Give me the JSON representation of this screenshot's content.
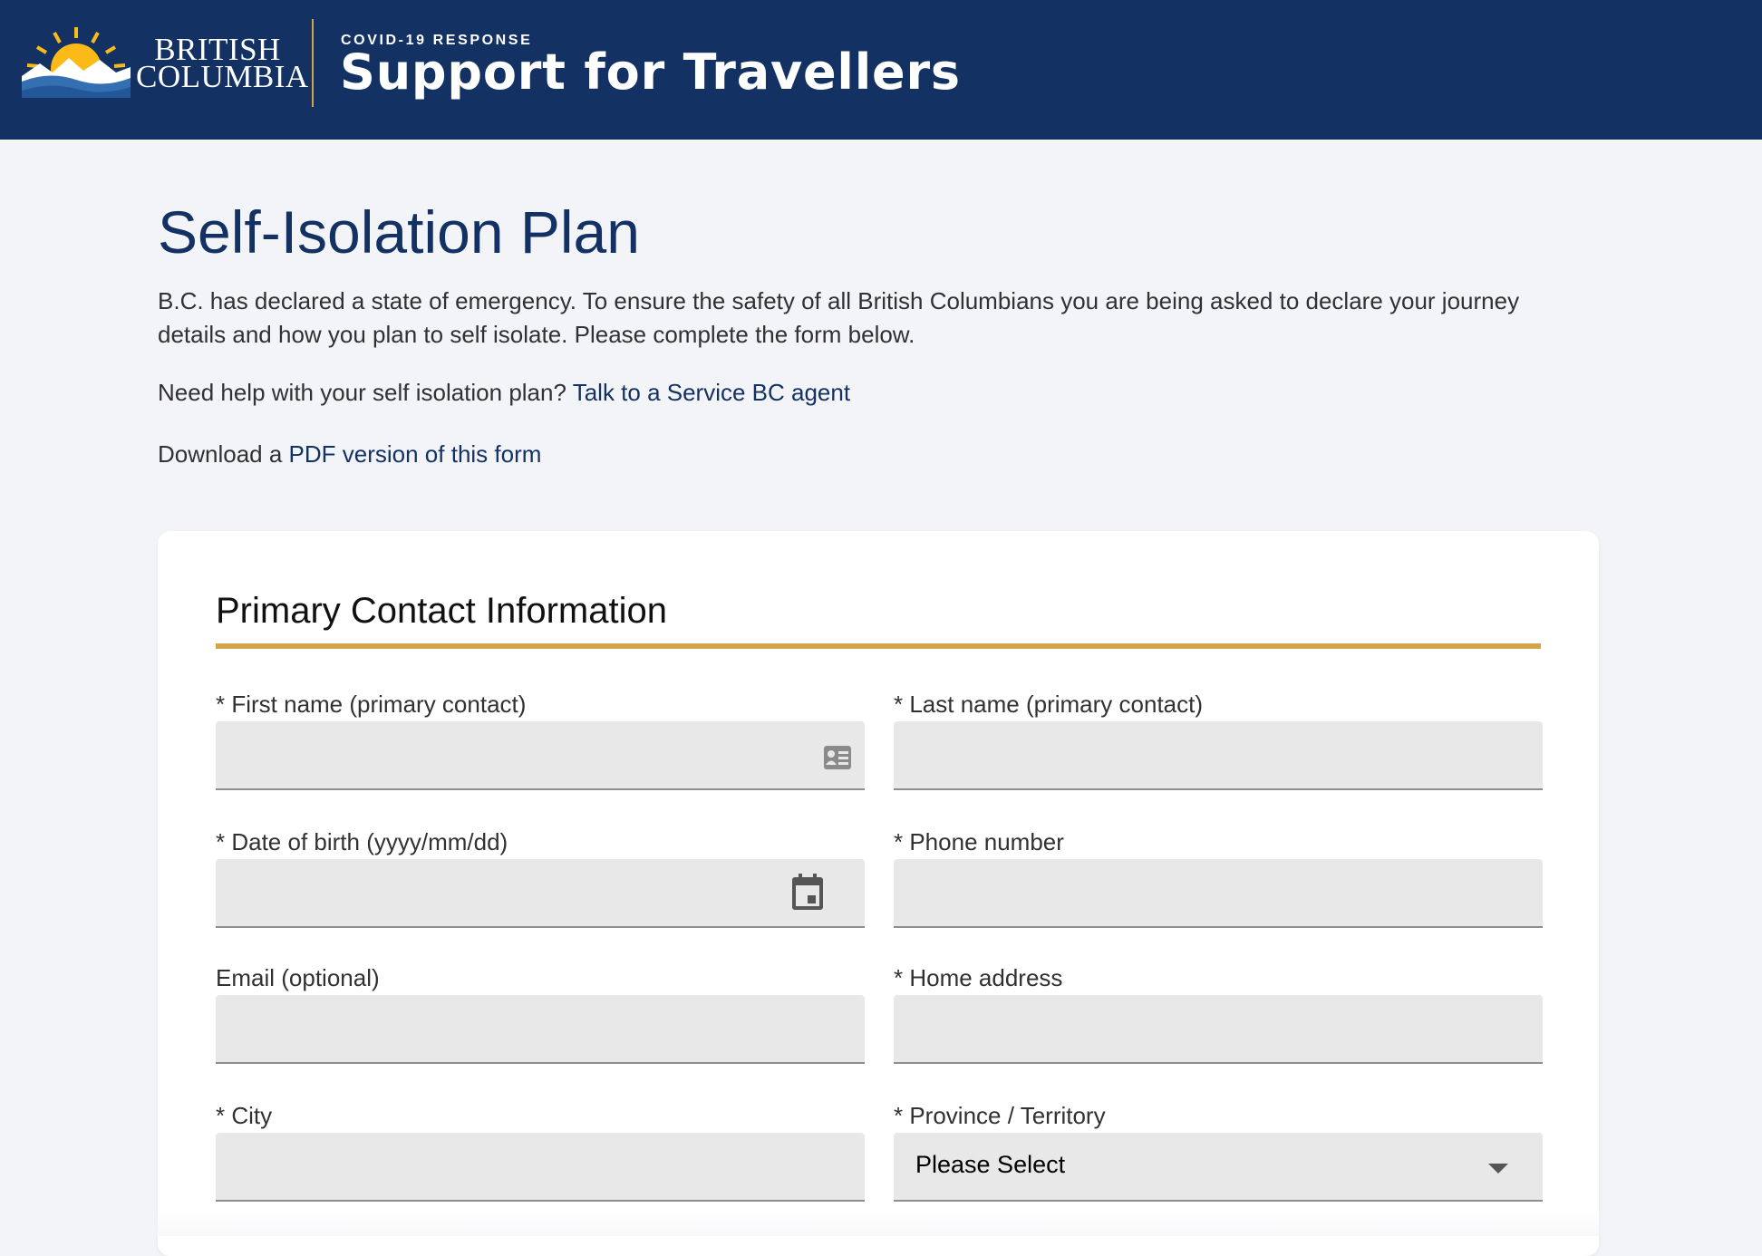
{
  "header": {
    "logo_line1": "BRITISH",
    "logo_line2": "COLUMBIA",
    "eyebrow": "COVID-19 RESPONSE",
    "title": "Support for Travellers"
  },
  "intro": {
    "title": "Self-Isolation Plan",
    "description": "B.C. has declared a state of emergency. To ensure the safety of all British Columbians you are being asked to declare your journey details and how you plan to self isolate. Please complete the form below.",
    "help_text": "Need help with your self isolation plan? ",
    "help_link": "Talk to a Service BC agent",
    "download_text": "Download a ",
    "download_link": "PDF version of this form"
  },
  "form": {
    "section_title": "Primary Contact Information",
    "fields": {
      "first_name": {
        "label": "* First name (primary contact)",
        "value": ""
      },
      "last_name": {
        "label": "* Last name (primary contact)",
        "value": ""
      },
      "dob": {
        "label": "* Date of birth (yyyy/mm/dd)",
        "value": ""
      },
      "phone": {
        "label": "* Phone number",
        "value": ""
      },
      "email": {
        "label": "Email (optional)",
        "value": ""
      },
      "home_address": {
        "label": "* Home address",
        "value": ""
      },
      "city": {
        "label": "* City",
        "value": ""
      },
      "province": {
        "label": "* Province / Territory",
        "selected": "Please Select"
      }
    }
  },
  "icons": {
    "contact_card": "contact-card-icon",
    "calendar": "calendar-icon",
    "dropdown": "chevron-down-icon"
  },
  "colors": {
    "header_bg": "#133263",
    "accent_gold": "#d3a54a",
    "link": "#133263",
    "input_bg": "#e8e8e8"
  }
}
